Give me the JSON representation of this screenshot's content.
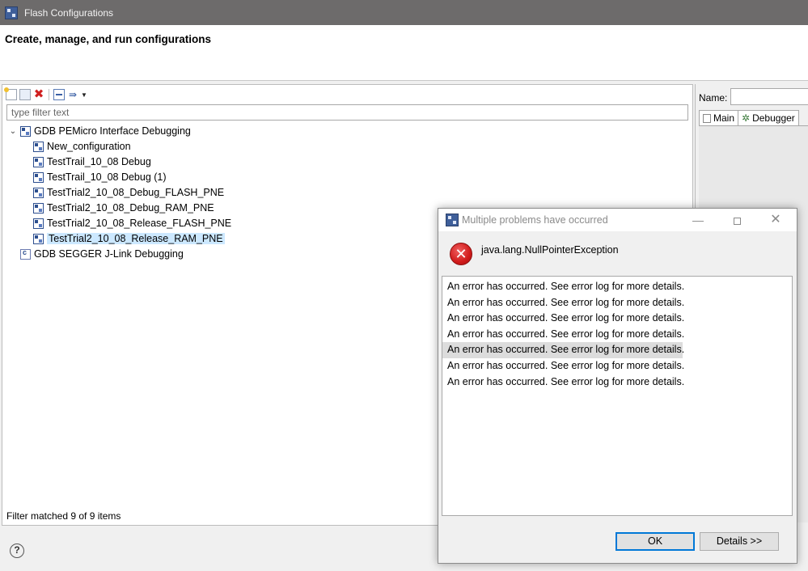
{
  "window": {
    "title": "Flash Configurations"
  },
  "header": {
    "heading": "Create, manage, and run configurations"
  },
  "left_panel": {
    "filter_placeholder": "type filter text",
    "tree": [
      {
        "label": "GDB PEMicro Interface Debugging",
        "level": 0,
        "expanded": true,
        "icon": "debug-config-group-icon"
      },
      {
        "label": "New_configuration",
        "level": 1,
        "icon": "debug-config-icon"
      },
      {
        "label": "TestTrail_10_08 Debug",
        "level": 1,
        "icon": "debug-config-icon"
      },
      {
        "label": "TestTrail_10_08 Debug (1)",
        "level": 1,
        "icon": "debug-config-icon"
      },
      {
        "label": "TestTrial2_10_08_Debug_FLASH_PNE",
        "level": 1,
        "icon": "debug-config-icon"
      },
      {
        "label": "TestTrial2_10_08_Debug_RAM_PNE",
        "level": 1,
        "icon": "debug-config-icon"
      },
      {
        "label": "TestTrial2_10_08_Release_FLASH_PNE",
        "level": 1,
        "icon": "debug-config-icon"
      },
      {
        "label": "TestTrial2_10_08_Release_RAM_PNE",
        "level": 1,
        "icon": "debug-config-icon",
        "selected": true
      },
      {
        "label": "GDB SEGGER J-Link Debugging",
        "level": 0,
        "icon": "c-config-group-icon"
      }
    ],
    "status": "Filter matched 9 of 9 items"
  },
  "right_panel": {
    "name_label": "Name:",
    "name_value": "",
    "tabs": [
      "Main",
      "Debugger"
    ]
  },
  "dialog": {
    "title": "Multiple problems have occurred",
    "exception": "java.lang.NullPointerException",
    "errors": [
      "An error has occurred. See error log for more details.",
      "An error has occurred. See error log for more details.",
      "An error has occurred. See error log for more details.",
      "An error has occurred. See error log for more details.",
      "An error has occurred. See error log for more details.",
      "An error has occurred. See error log for more details.",
      "An error has occurred. See error log for more details."
    ],
    "highlighted_index": 4,
    "ok_label": "OK",
    "details_label": "Details >>",
    "minimize_glyph": "—",
    "close_glyph": "✕"
  },
  "colors": {
    "title_bar": "#6d6b6b",
    "selection": "#cce8ff",
    "error_red": "#d11b1b",
    "focus_blue": "#0078d7"
  }
}
